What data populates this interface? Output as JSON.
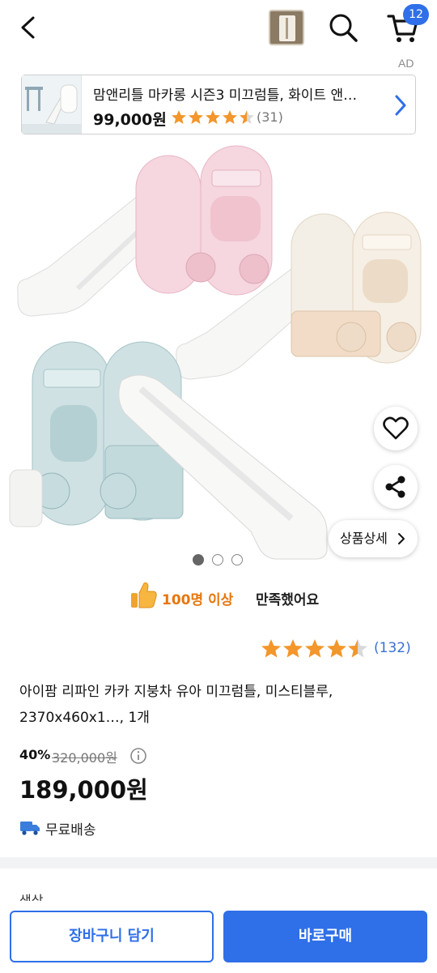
{
  "header": {
    "back_icon": "chevron-left-icon",
    "search_icon": "search-icon",
    "cart_icon": "cart-icon",
    "cart_count": "12",
    "ad_label": "AD"
  },
  "ad": {
    "title": "맘앤리틀 마카롱 시즌3 미끄럼틀, 화이트 앤…",
    "price": "99,000원",
    "rating_count": "(31)",
    "rating": 4.5
  },
  "gallery": {
    "detail_button": "상품상세",
    "image_count": 3,
    "active_index": 0,
    "like_icon": "heart-icon",
    "share_icon": "share-icon"
  },
  "satisfaction": {
    "highlight": "100명 이상",
    "rest": "만족했어요"
  },
  "product": {
    "rating": 4.5,
    "review_count": "(132)",
    "name": "아이팜 리파인 카카 지붕차 유아 미끄럼틀, 미스티블루, 2370x460x1…, 1개",
    "discount": "40%",
    "original_price": "320,000원",
    "price": "189,000원",
    "shipping": "무료배송"
  },
  "options": {
    "label": "색상"
  },
  "bottom": {
    "cart_button": "장바구니 담기",
    "buy_button": "바로구매"
  },
  "colors": {
    "accent": "#2f6fe8",
    "star": "#f3962b",
    "satisfaction": "#e8760c"
  }
}
